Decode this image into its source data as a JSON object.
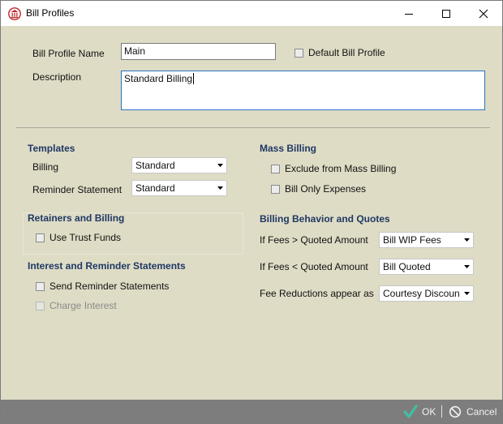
{
  "window": {
    "title": "Bill Profiles"
  },
  "form": {
    "profile_name_label": "Bill Profile Name",
    "profile_name_value": "Main",
    "default_profile_label": "Default Bill Profile",
    "description_label": "Description",
    "description_value": "Standard Billing"
  },
  "templates": {
    "heading": "Templates",
    "billing_label": "Billing",
    "billing_value": "Standard",
    "reminder_label": "Reminder Statement",
    "reminder_value": "Standard"
  },
  "retainers": {
    "heading": "Retainers and Billing",
    "use_trust_funds_label": "Use Trust Funds"
  },
  "interest": {
    "heading": "Interest and Reminder Statements",
    "send_reminder_label": "Send Reminder Statements",
    "charge_interest_label": "Charge Interest"
  },
  "mass_billing": {
    "heading": "Mass Billing",
    "exclude_label": "Exclude from Mass Billing",
    "expenses_only_label": "Bill Only Expenses"
  },
  "behavior": {
    "heading": "Billing Behavior and Quotes",
    "fees_greater_label": "If Fees > Quoted Amount",
    "fees_greater_value": "Bill WIP Fees",
    "fees_less_label": "If Fees < Quoted Amount",
    "fees_less_value": "Bill Quoted",
    "fee_reductions_label": "Fee Reductions appear as",
    "fee_reductions_value": "Courtesy Discount"
  },
  "footer": {
    "ok_label": "OK",
    "cancel_label": "Cancel"
  },
  "colors": {
    "panel": "#dedcc5",
    "section_heading": "#1f3864",
    "footer": "#7d7d7d",
    "ok_check": "#3fc1a7"
  }
}
